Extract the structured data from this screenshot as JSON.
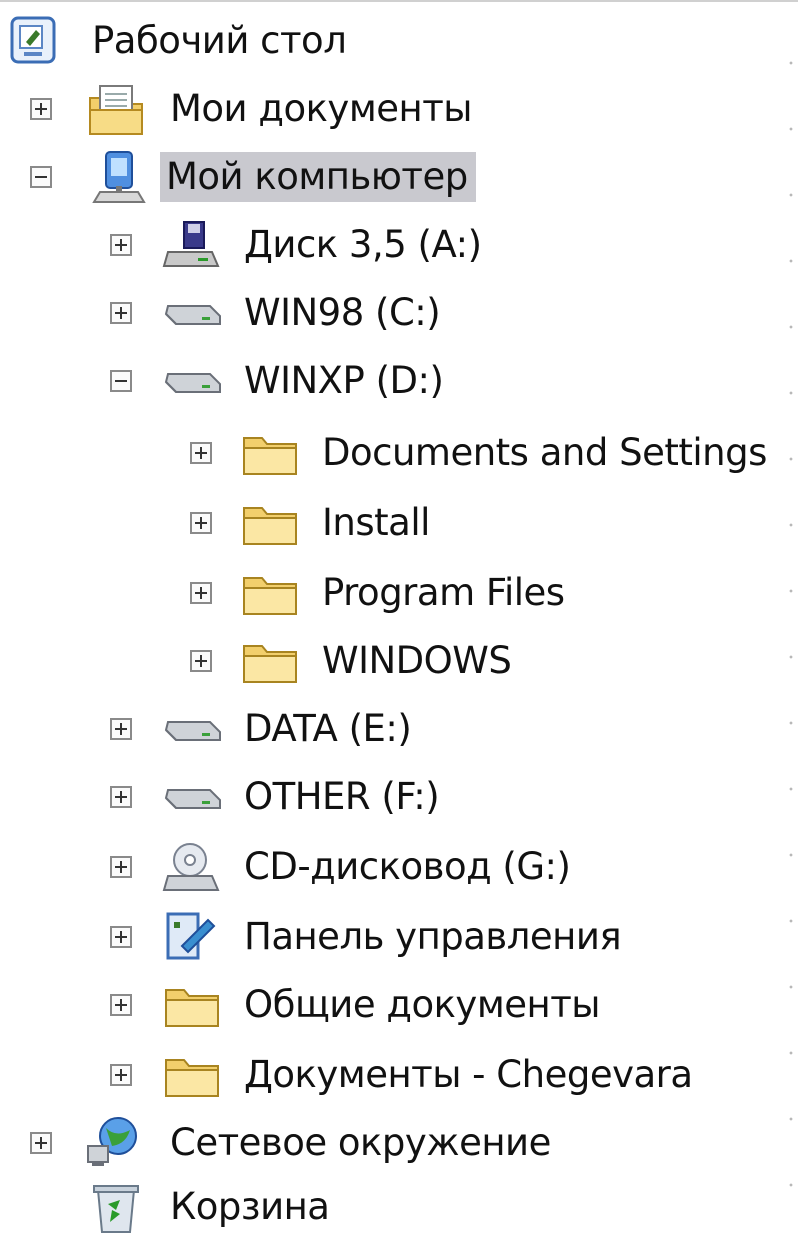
{
  "tree": {
    "items": [
      {
        "label": "Рабочий стол",
        "icon": "desktop-icon",
        "expander": "none"
      },
      {
        "label": "Мои документы",
        "icon": "my-documents-icon",
        "expander": "collapsed"
      },
      {
        "label": "Мой компьютер",
        "icon": "my-computer-icon",
        "expander": "expanded",
        "selected": true
      },
      {
        "label": "Диск 3,5 (A:)",
        "icon": "floppy-drive-icon",
        "expander": "collapsed"
      },
      {
        "label": "WIN98 (C:)",
        "icon": "hard-drive-icon",
        "expander": "collapsed"
      },
      {
        "label": "WINXP (D:)",
        "icon": "hard-drive-icon",
        "expander": "expanded"
      },
      {
        "label": "Documents and Settings",
        "icon": "folder-icon",
        "expander": "collapsed"
      },
      {
        "label": "Install",
        "icon": "folder-icon",
        "expander": "collapsed"
      },
      {
        "label": "Program Files",
        "icon": "folder-icon",
        "expander": "collapsed"
      },
      {
        "label": "WINDOWS",
        "icon": "folder-icon",
        "expander": "collapsed"
      },
      {
        "label": "DATA (E:)",
        "icon": "hard-drive-icon",
        "expander": "collapsed"
      },
      {
        "label": "OTHER (F:)",
        "icon": "hard-drive-icon",
        "expander": "collapsed"
      },
      {
        "label": "CD-дисковод (G:)",
        "icon": "cd-drive-icon",
        "expander": "collapsed"
      },
      {
        "label": "Панель управления",
        "icon": "control-panel-icon",
        "expander": "collapsed"
      },
      {
        "label": "Общие документы",
        "icon": "folder-icon",
        "expander": "collapsed"
      },
      {
        "label": "Документы - Chegevara",
        "icon": "folder-icon",
        "expander": "collapsed"
      },
      {
        "label": "Сетевое окружение",
        "icon": "network-icon",
        "expander": "collapsed"
      },
      {
        "label": "Корзина",
        "icon": "recycle-bin-icon",
        "expander": "none"
      }
    ]
  },
  "colors": {
    "selection": "#c9c9cf",
    "folder": "#f5d77a",
    "background": "#ffffff"
  }
}
